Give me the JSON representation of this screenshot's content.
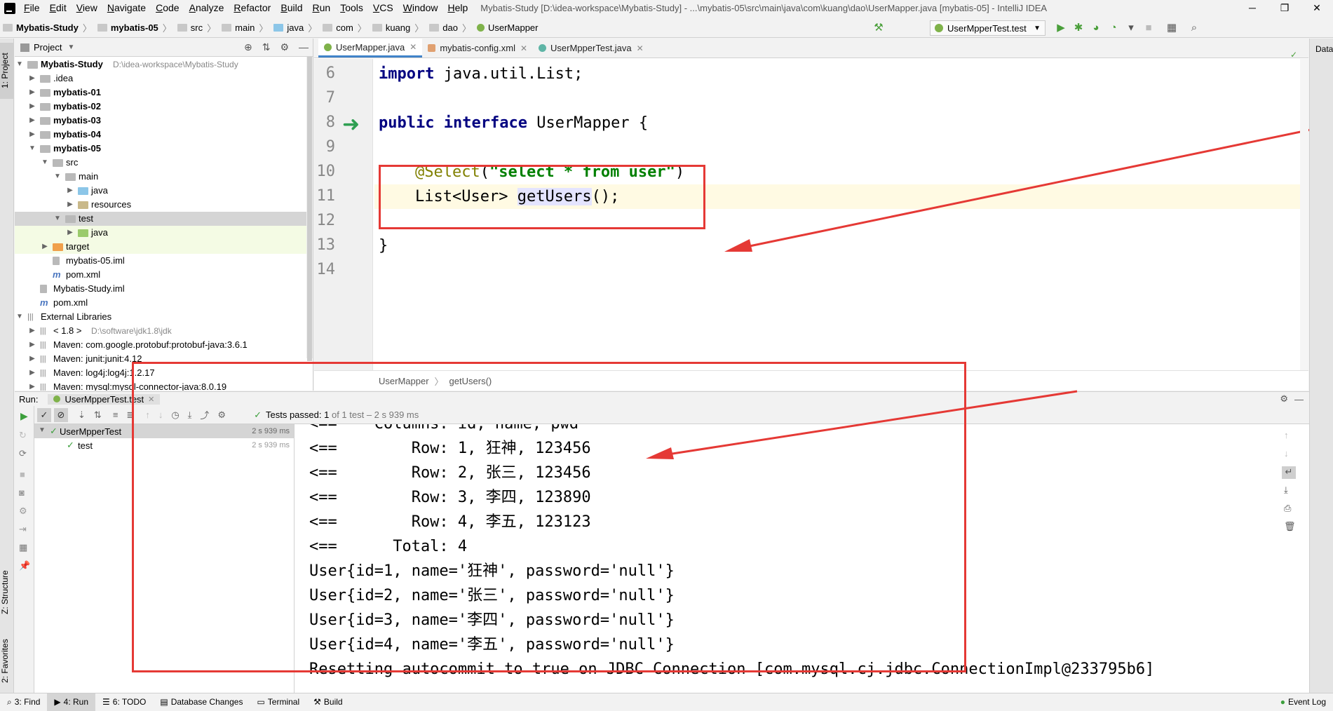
{
  "menubar": {
    "items": [
      "File",
      "Edit",
      "View",
      "Navigate",
      "Code",
      "Analyze",
      "Refactor",
      "Build",
      "Run",
      "Tools",
      "VCS",
      "Window",
      "Help"
    ],
    "window_title": "Mybatis-Study [D:\\idea-workspace\\Mybatis-Study] - ...\\mybatis-05\\src\\main\\java\\com\\kuang\\dao\\UserMapper.java [mybatis-05] - IntelliJ IDEA"
  },
  "navbar": {
    "crumbs": [
      "Mybatis-Study",
      "mybatis-05",
      "src",
      "main",
      "java",
      "com",
      "kuang",
      "dao",
      "UserMapper"
    ],
    "run_config": "UserMpperTest.test"
  },
  "left_strip": {
    "project_tab": "1: Project",
    "structure_tab": "Z: Structure",
    "favorites_tab": "2: Favorites"
  },
  "right_strip": {
    "database_tab": "Data"
  },
  "project": {
    "header": "Project",
    "tree": [
      {
        "label": "Mybatis-Study",
        "extra": "D:\\idea-workspace\\Mybatis-Study",
        "bold": true
      },
      {
        "label": ".idea"
      },
      {
        "label": "mybatis-01",
        "bold": true
      },
      {
        "label": "mybatis-02",
        "bold": true
      },
      {
        "label": "mybatis-03",
        "bold": true
      },
      {
        "label": "mybatis-04",
        "bold": true
      },
      {
        "label": "mybatis-05",
        "bold": true
      },
      {
        "label": "src"
      },
      {
        "label": "main"
      },
      {
        "label": "java"
      },
      {
        "label": "resources"
      },
      {
        "label": "test"
      },
      {
        "label": "java"
      },
      {
        "label": "target"
      },
      {
        "label": "mybatis-05.iml"
      },
      {
        "label": "pom.xml"
      },
      {
        "label": "Mybatis-Study.iml"
      },
      {
        "label": "pom.xml"
      },
      {
        "label": "External Libraries"
      },
      {
        "label": "< 1.8 >",
        "extra": "D:\\software\\jdk1.8\\jdk"
      },
      {
        "label": "Maven: com.google.protobuf:protobuf-java:3.6.1"
      },
      {
        "label": "Maven: junit:junit:4.12"
      },
      {
        "label": "Maven: log4j:log4j:1.2.17"
      },
      {
        "label": "Maven: mysql:mysql-connector-java:8.0.19"
      }
    ]
  },
  "editor": {
    "tabs": [
      "UserMapper.java",
      "mybatis-config.xml",
      "UserMpperTest.java"
    ],
    "line_numbers": [
      "6",
      "7",
      "8",
      "9",
      "10",
      "11",
      "12",
      "13",
      "14"
    ],
    "code": {
      "l6_kw": "import",
      "l6_rest": " java.util.List;",
      "l8_kw1": "public",
      "l8_kw2": "interface",
      "l8_rest": " UserMapper {",
      "l10_ann": "@Select",
      "l10_open": "(",
      "l10_str": "\"select * from user\"",
      "l10_close": ")",
      "l11_a": "List<User> ",
      "l11_m": "getUsers",
      "l11_b": "();",
      "l13": "}"
    },
    "breadcrumb": [
      "UserMapper",
      "getUsers()"
    ]
  },
  "run": {
    "label": "Run:",
    "tab": "UserMpperTest.test",
    "status_bold": "Tests passed:",
    "status_count": "1",
    "status_rest": "of 1 test – 2 s 939 ms",
    "tree": [
      {
        "label": "UserMpperTest",
        "time": "2 s 939 ms"
      },
      {
        "label": "test",
        "time": "2 s 939 ms"
      }
    ],
    "console": [
      "<==    Columns: id, name, pwd",
      "<==        Row: 1, 狂神, 123456",
      "<==        Row: 2, 张三, 123456",
      "<==        Row: 3, 李四, 123890",
      "<==        Row: 4, 李五, 123123",
      "<==      Total: 4",
      "User{id=1, name='狂神', password='null'}",
      "User{id=2, name='张三', password='null'}",
      "User{id=3, name='李四', password='null'}",
      "User{id=4, name='李五', password='null'}",
      "Resetting autocommit to true on JDBC Connection [com.mysql.cj.jdbc.ConnectionImpl@233795b6]"
    ]
  },
  "statusbar": {
    "items": [
      "3: Find",
      "4: Run",
      "6: TODO",
      "Database Changes",
      "Terminal",
      "Build"
    ],
    "event_log": "Event Log"
  },
  "colors": {
    "annotation_box": "#e53935",
    "accent": "#4083c9",
    "keyword": "#000080",
    "string": "#008000"
  }
}
